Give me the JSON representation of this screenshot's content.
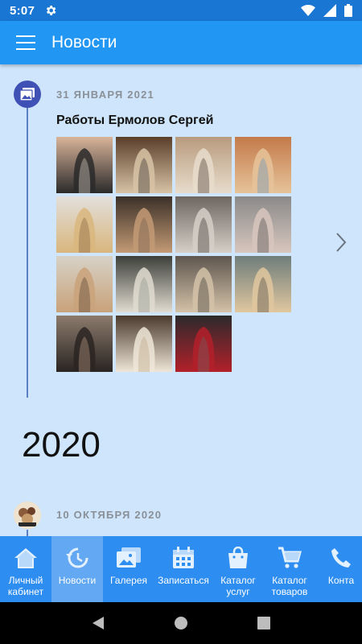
{
  "status_bar": {
    "time": "5:07"
  },
  "app_bar": {
    "title": "Новости"
  },
  "posts": [
    {
      "date": "31 ЯНВАРЯ 2021",
      "title": "Работы Ермолов Сергей",
      "photos": [
        {
          "top": "#d9b49a",
          "bottom": "#2a2a2a",
          "accent": "#f1e6d8"
        },
        {
          "top": "#5a3e2a",
          "bottom": "#d8c3a6",
          "accent": "#222"
        },
        {
          "top": "#b89b7e",
          "bottom": "#e7dccb",
          "accent": "#3a2a22"
        },
        {
          "top": "#c37a4a",
          "bottom": "#e6c39a",
          "accent": "#5a8fc0"
        },
        {
          "top": "#e2dfdc",
          "bottom": "#d9b67d",
          "accent": "#7b5a3a"
        },
        {
          "top": "#3b3028",
          "bottom": "#c39a75",
          "accent": "#6d5a4a"
        },
        {
          "top": "#6e6661",
          "bottom": "#d6cfc7",
          "accent": "#2a2522"
        },
        {
          "top": "#8a8a8a",
          "bottom": "#d7c6bd",
          "accent": "#3c3c3c"
        },
        {
          "top": "#d7d2c7",
          "bottom": "#c9a27a",
          "accent": "#4b3a2c"
        },
        {
          "top": "#3d3f3a",
          "bottom": "#e1dcd0",
          "accent": "#8a8f86"
        },
        {
          "top": "#5e564f",
          "bottom": "#d4c2a8",
          "accent": "#2c2724"
        },
        {
          "top": "#6f7d7b",
          "bottom": "#e0c79f",
          "accent": "#3b3b3b"
        },
        {
          "top": "#8c7b6d",
          "bottom": "#2a2422",
          "accent": "#caa98e"
        },
        {
          "top": "#4a3a2d",
          "bottom": "#efe6d8",
          "accent": "#b8a07e"
        },
        {
          "top": "#2c2a2c",
          "bottom": "#b3202a",
          "accent": "#6a6a6a"
        }
      ]
    },
    {
      "date": "10 ОКТЯБРЯ 2020"
    }
  ],
  "year_heading": "2020",
  "bottom_nav": [
    {
      "label": "Личный кабинет",
      "icon": "home-icon"
    },
    {
      "label": "Новости",
      "icon": "history-icon"
    },
    {
      "label": "Галерея",
      "icon": "gallery-icon"
    },
    {
      "label": "Записаться",
      "icon": "calendar-icon"
    },
    {
      "label": "Каталог услуг",
      "icon": "bag-icon"
    },
    {
      "label": "Каталог товаров",
      "icon": "cart-icon"
    },
    {
      "label": "Конта",
      "icon": "phone-icon"
    }
  ],
  "colors": {
    "primary": "#2196f3",
    "status_bar": "#1976d2",
    "background": "#cfe5fb",
    "timeline": "#5b7fc5",
    "nav": "#2e8df0",
    "nav_active": "#63a8f2"
  }
}
